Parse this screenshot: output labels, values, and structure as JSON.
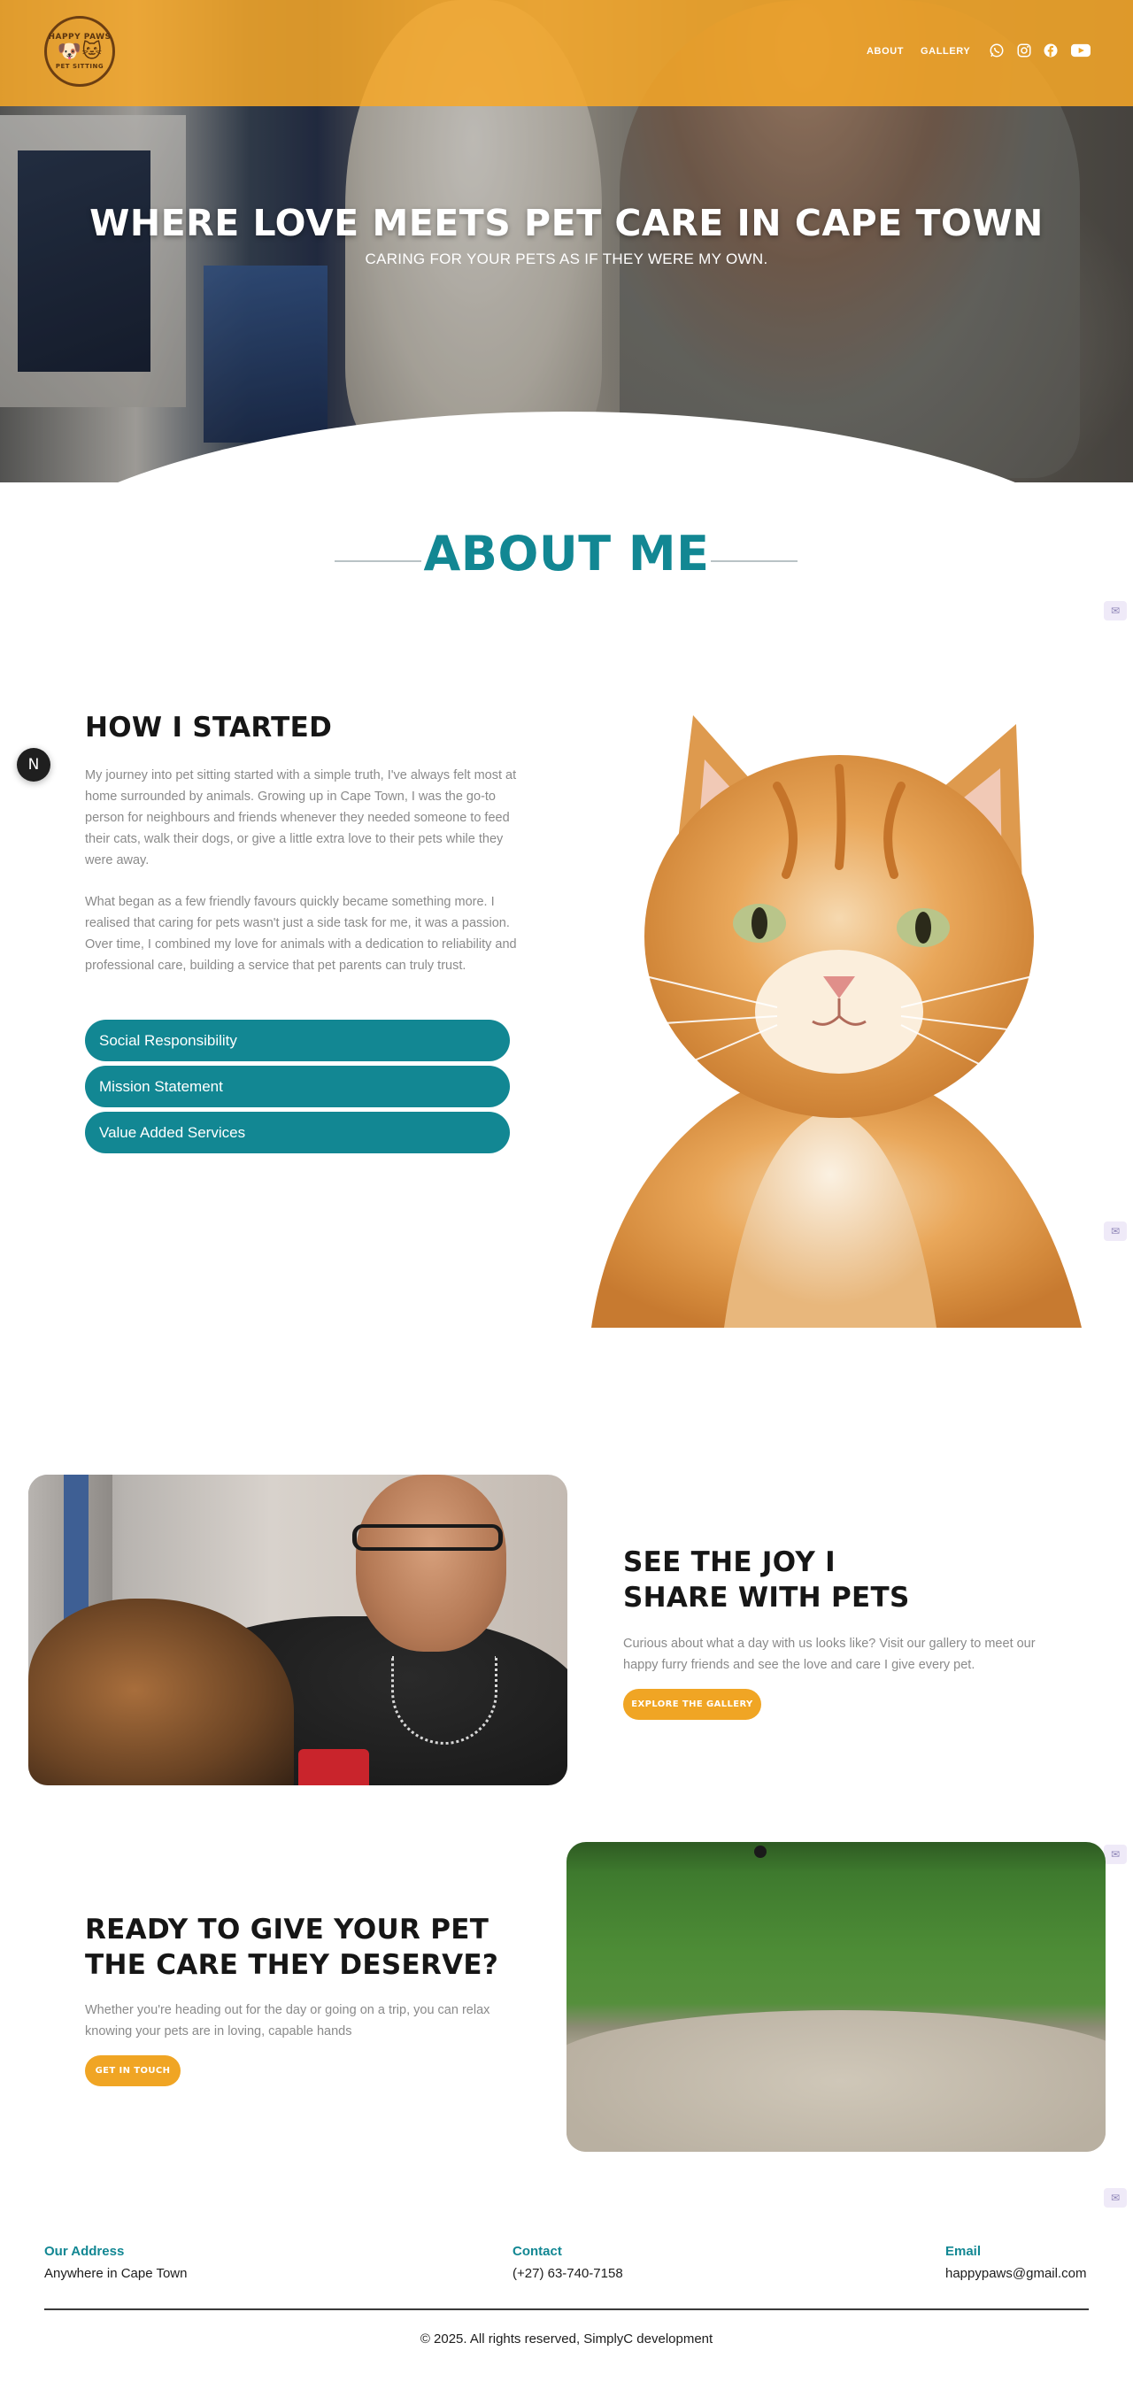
{
  "header": {
    "logo_top": "HAPPY PAWS",
    "logo_bottom": "PET SITTING",
    "nav": [
      "ABOUT",
      "GALLERY"
    ],
    "social": [
      "whatsapp-icon",
      "instagram-icon",
      "facebook-icon",
      "youtube-icon"
    ],
    "bg_color": "#f7a828"
  },
  "hero": {
    "title": "WHERE LOVE MEETS PET CARE IN CAPE TOWN",
    "subtitle": "CARING FOR YOUR PETS AS IF THEY WERE MY OWN."
  },
  "about": {
    "title": "ABOUT ME",
    "color": "#128793"
  },
  "how_started": {
    "title": "HOW I STARTED",
    "p1": "My journey into pet sitting started with a simple truth, I've always felt most at home surrounded by animals. Growing up in Cape Town, I was the go-to person for neighbours and friends whenever they needed someone to feed their cats, walk their dogs, or give a little extra love to their pets while they were away.",
    "p2": "What began as a few friendly favours quickly became something more. I realised that caring for pets wasn't just a side task for me, it was a passion. Over time, I combined my love for animals with a dedication to reliability and professional care, building a service that pet parents can truly trust.",
    "buttons": [
      "Social Responsibility",
      "Mission Statement",
      "Value Added Services"
    ]
  },
  "joy": {
    "title_line1": "SEE THE JOY I",
    "title_line2": "SHARE WITH PETS",
    "text": "Curious about what a day with us looks like? Visit our gallery to meet our happy furry friends and see the love and care I give every pet.",
    "button": "EXPLORE THE GALLERY"
  },
  "ready": {
    "title_line1": "READY TO GIVE YOUR PET",
    "title_line2": "THE CARE THEY DESERVE?",
    "text": "Whether you're heading out for the day or going on a trip, you can relax knowing your pets are in loving, capable hands",
    "button": "GET IN TOUCH"
  },
  "footer": {
    "address_label": "Our Address",
    "address_value": "Anywhere in Cape Town",
    "contact_label": "Contact",
    "contact_value": "(+27) 63-740-7158",
    "email_label": "Email",
    "email_value": "happypaws@gmail.com",
    "copyright": "© 2025. All rights reserved, SimplyC development"
  },
  "floating": {
    "badge_letter": "N"
  }
}
